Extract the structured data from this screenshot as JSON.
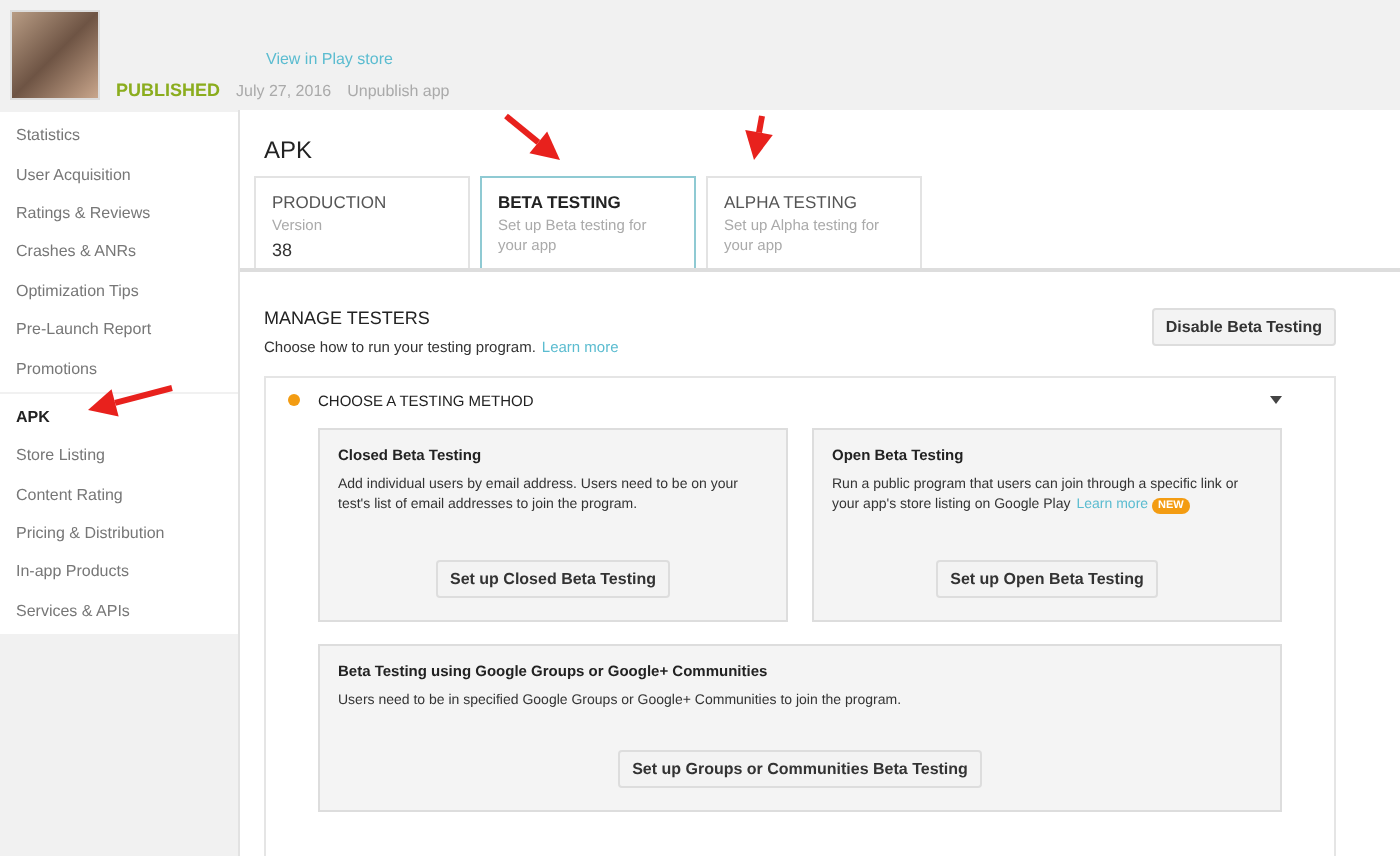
{
  "header": {
    "play_store_link": "View in Play store",
    "status": "PUBLISHED",
    "date": "July 27, 2016",
    "unpublish_link": "Unpublish app"
  },
  "sidebar": {
    "groups": [
      [
        {
          "label": "Statistics",
          "selected": false
        },
        {
          "label": "User Acquisition",
          "selected": false
        },
        {
          "label": "Ratings & Reviews",
          "selected": false
        },
        {
          "label": "Crashes & ANRs",
          "selected": false
        },
        {
          "label": "Optimization Tips",
          "selected": false
        },
        {
          "label": "Pre-Launch Report",
          "selected": false
        },
        {
          "label": "Promotions",
          "selected": false
        }
      ],
      [
        {
          "label": "APK",
          "selected": true
        },
        {
          "label": "Store Listing",
          "selected": false
        },
        {
          "label": "Content Rating",
          "selected": false
        },
        {
          "label": "Pricing & Distribution",
          "selected": false
        },
        {
          "label": "In-app Products",
          "selected": false
        },
        {
          "label": "Services & APIs",
          "selected": false
        }
      ]
    ]
  },
  "main": {
    "title": "APK",
    "tabs": [
      {
        "kind": "version",
        "title": "PRODUCTION",
        "caption": "Version",
        "value": "38",
        "selected": false
      },
      {
        "kind": "setup",
        "title": "BETA TESTING",
        "caption": "Set up Beta testing for your app",
        "selected": true
      },
      {
        "kind": "setup",
        "title": "ALPHA TESTING",
        "caption": "Set up Alpha testing for your app",
        "selected": false
      }
    ],
    "manage": {
      "title": "MANAGE TESTERS",
      "description": "Choose how to run your testing program.",
      "learn_more": "Learn more",
      "button": "Disable Beta Testing"
    },
    "method": {
      "title": "CHOOSE A TESTING METHOD",
      "expanded": true,
      "cards": [
        {
          "title": "Closed Beta Testing",
          "description": "Add individual users by email address. Users need to be on your test's list of email addresses to join the program.",
          "button": "Set up Closed Beta Testing"
        },
        {
          "title": "Open Beta Testing",
          "description": "Run a public program that users can join through a specific link or your app's store listing on Google Play",
          "link": "Learn more",
          "badge": "NEW",
          "button": "Set up Open Beta Testing"
        },
        {
          "title": "Beta Testing using Google Groups or Google+ Communities",
          "description": "Users need to be in specified Google Groups or Google+ Communities to join the program.",
          "button": "Set up Groups or Communities Beta Testing"
        }
      ]
    }
  }
}
